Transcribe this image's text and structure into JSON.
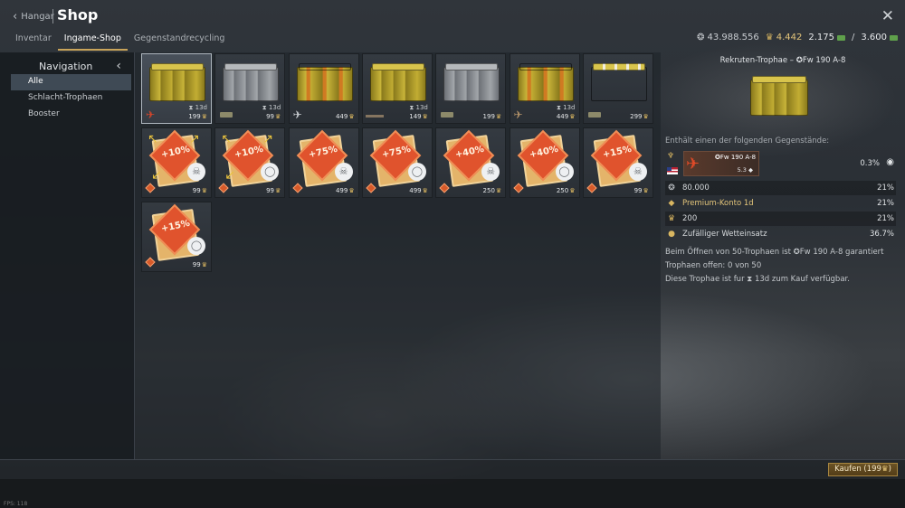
{
  "header": {
    "back_label": "Hangar",
    "title": "Shop",
    "tabs": [
      {
        "label": "Inventar"
      },
      {
        "label": "Ingame-Shop"
      },
      {
        "label": "Gegenstandrecycling"
      }
    ],
    "currencies": {
      "silver": "43.988.556",
      "golden_eagles": "4.442",
      "xp_current": "2.175",
      "xp_separator": "/",
      "xp_total": "3.600"
    }
  },
  "navigation": {
    "title": "Navigation",
    "items": [
      {
        "label": "Alle"
      },
      {
        "label": "Schlacht-Trophaen"
      },
      {
        "label": "Booster"
      }
    ]
  },
  "items": [
    {
      "type": "crate",
      "style": "gold",
      "timer": "13d",
      "price": "199",
      "icon": "plane-icon",
      "selected": true
    },
    {
      "type": "crate",
      "style": "grey",
      "timer": "13d",
      "price": "99",
      "icon": "tank-icon"
    },
    {
      "type": "crate",
      "style": "orange-stripe",
      "timer": "",
      "price": "449",
      "icon": "jet-icon"
    },
    {
      "type": "crate",
      "style": "gold",
      "timer": "13d",
      "price": "149",
      "icon": "ship-icon"
    },
    {
      "type": "crate",
      "style": "grey",
      "timer": "",
      "price": "199",
      "icon": "tank-icon"
    },
    {
      "type": "crate",
      "style": "orange-stripe",
      "timer": "13d",
      "price": "449",
      "icon": "plane-icon"
    },
    {
      "type": "crate",
      "style": "white-stripe",
      "timer": "",
      "price": "299",
      "icon": "tank-icon"
    },
    {
      "type": "booster",
      "text": "+10%",
      "badge": "wolf-icon",
      "price": "99",
      "arrows": true
    },
    {
      "type": "booster",
      "text": "+10%",
      "badge": "bulb-icon",
      "price": "99",
      "arrows": true
    },
    {
      "type": "booster",
      "text": "+75%",
      "badge": "wolf-icon",
      "price": "499"
    },
    {
      "type": "booster",
      "text": "+75%",
      "badge": "bulb-icon",
      "price": "499"
    },
    {
      "type": "booster",
      "text": "+40%",
      "badge": "wolf-icon",
      "price": "250"
    },
    {
      "type": "booster",
      "text": "+40%",
      "badge": "bulb-icon",
      "price": "250"
    },
    {
      "type": "booster",
      "text": "+15%",
      "badge": "wolf-icon",
      "price": "99"
    },
    {
      "type": "booster",
      "text": "+15%",
      "badge": "bulb-icon",
      "price": "99"
    }
  ],
  "details": {
    "title": "Rekruten-Trophae – ✪Fw 190 A-8",
    "contains_label": "Enthält einen der folgenden Gegenstände:",
    "vehicle": {
      "name": "✪Fw 190 A-8",
      "br": "5.3",
      "chance": "0.3%"
    },
    "contents": [
      {
        "icon": "silver-icon",
        "label": "80.000",
        "chance": "21%",
        "gold": false
      },
      {
        "icon": "premium-icon",
        "label": "Premium-Konto 1d",
        "chance": "21%",
        "gold": true
      },
      {
        "icon": "eagle-icon",
        "label": "200",
        "chance": "21%",
        "gold": false
      },
      {
        "icon": "wager-icon",
        "label": "Zufälliger Wetteinsatz",
        "chance": "36.7%",
        "gold": false
      }
    ],
    "info_lines": [
      "Beim Öffnen von 50-Trophaen ist ✪Fw 190 A-8 garantiert",
      "Trophaen offen: 0 von 50",
      "Diese Trophae ist fur ⧗ 13d zum Kauf verfügbar."
    ]
  },
  "footer": {
    "buy_label": "Kaufen (199",
    "fps": "FPS: 118"
  }
}
